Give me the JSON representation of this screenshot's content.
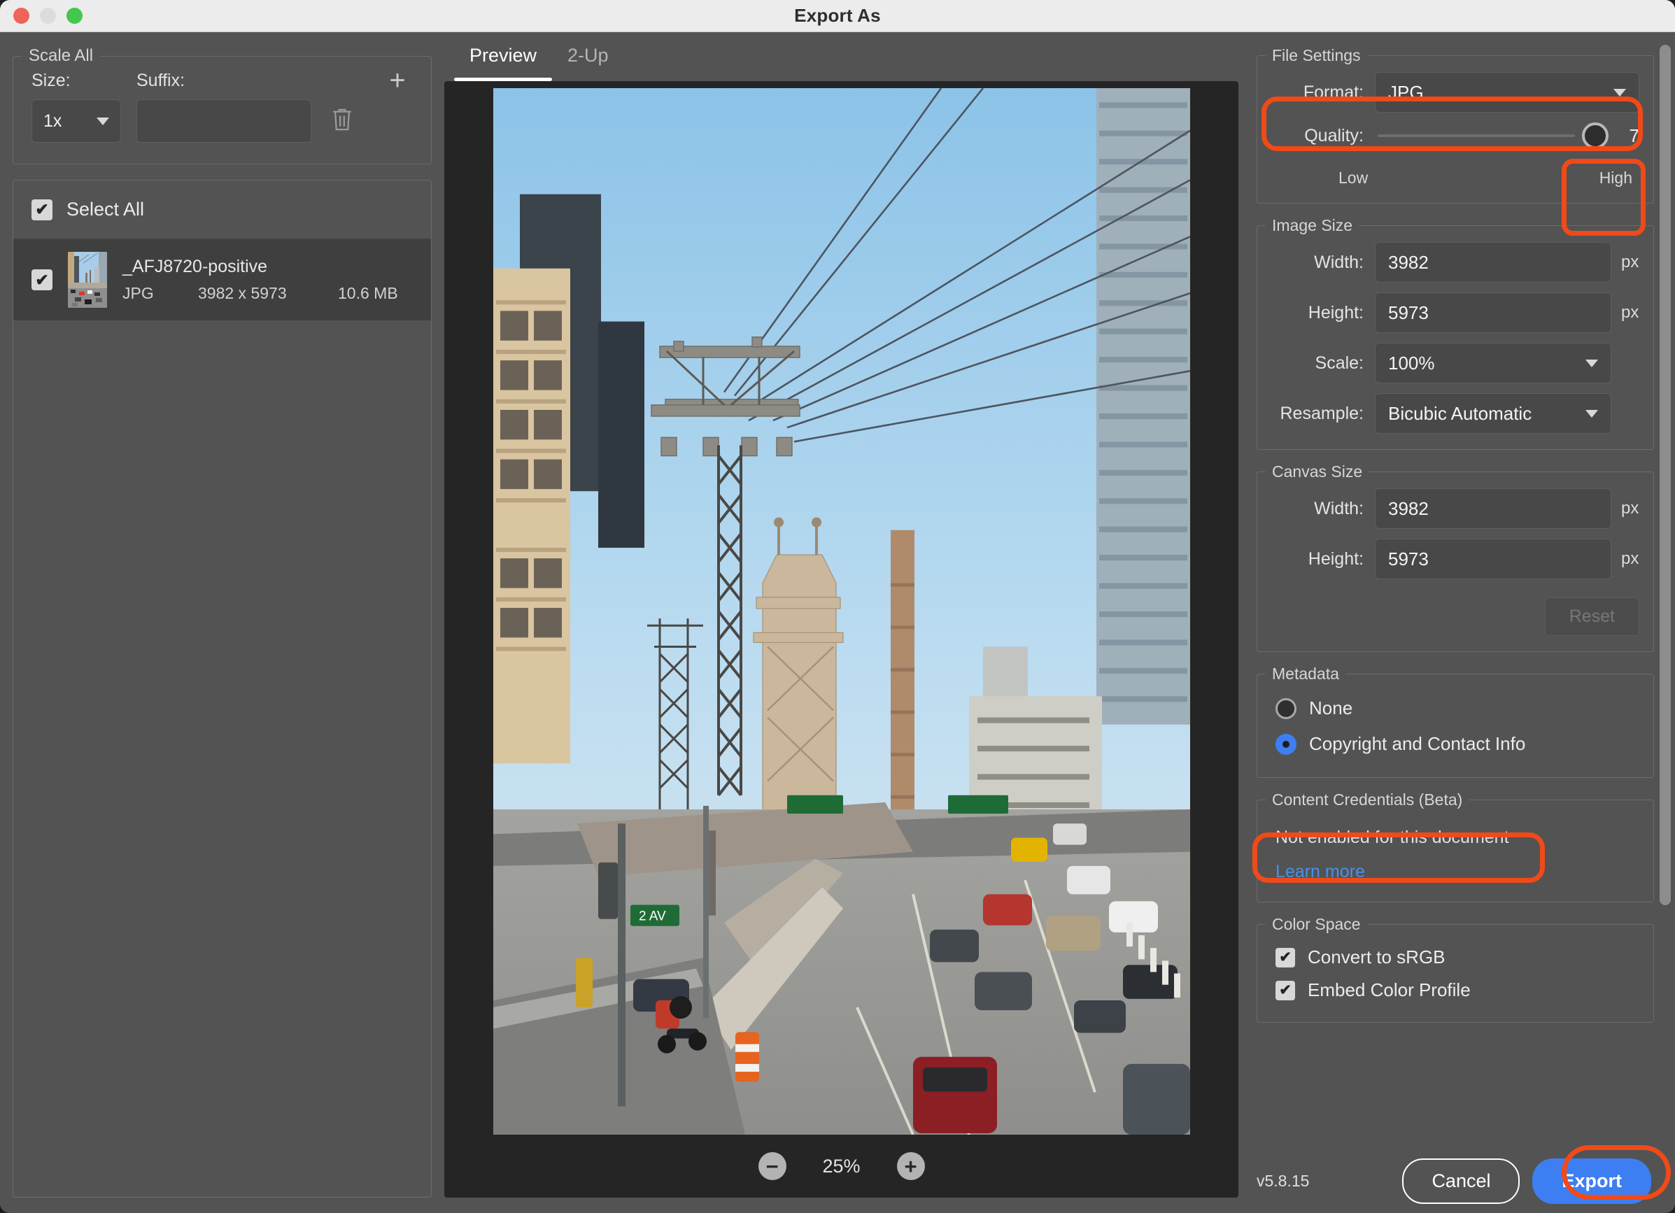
{
  "window": {
    "title": "Export As",
    "traffic_lights": [
      "close-red",
      "minimize-grey",
      "zoom-green"
    ]
  },
  "scale_all": {
    "legend": "Scale All",
    "size_label": "Size:",
    "suffix_label": "Suffix:",
    "size_value": "1x",
    "suffix_value": "",
    "suffix_placeholder": "",
    "add_icon": "+",
    "delete_icon": "trash-icon"
  },
  "file_list": {
    "select_all_label": "Select All",
    "select_all_checked": true,
    "items": [
      {
        "checked": true,
        "name": "_AFJ8720-positive",
        "type": "JPG",
        "dimensions": "3982 x 5973",
        "size": "10.6 MB"
      }
    ]
  },
  "preview": {
    "tabs": [
      {
        "label": "Preview",
        "active": true
      },
      {
        "label": "2-Up",
        "active": false
      }
    ],
    "zoom_out_icon": "−",
    "zoom_level": "25%",
    "zoom_in_icon": "+"
  },
  "file_settings": {
    "legend": "File Settings",
    "format_label": "Format:",
    "format_value": "JPG",
    "quality_label": "Quality:",
    "quality_value": "7",
    "quality_low_label": "Low",
    "quality_high_label": "High"
  },
  "image_size": {
    "legend": "Image Size",
    "width_label": "Width:",
    "width_value": "3982",
    "width_unit": "px",
    "height_label": "Height:",
    "height_value": "5973",
    "height_unit": "px",
    "scale_label": "Scale:",
    "scale_value": "100%",
    "resample_label": "Resample:",
    "resample_value": "Bicubic Automatic"
  },
  "canvas_size": {
    "legend": "Canvas Size",
    "width_label": "Width:",
    "width_value": "3982",
    "width_unit": "px",
    "height_label": "Height:",
    "height_value": "5973",
    "height_unit": "px",
    "reset_label": "Reset"
  },
  "metadata": {
    "legend": "Metadata",
    "options": [
      {
        "label": "None",
        "selected": false
      },
      {
        "label": "Copyright and Contact Info",
        "selected": true
      }
    ]
  },
  "content_credentials": {
    "legend": "Content Credentials (Beta)",
    "status": "Not enabled for this document",
    "link_label": "Learn more"
  },
  "color_space": {
    "legend": "Color Space",
    "options": [
      {
        "label": "Convert to sRGB",
        "checked": true
      },
      {
        "label": "Embed Color Profile",
        "checked": true
      }
    ]
  },
  "footer": {
    "version": "v5.8.15",
    "cancel_label": "Cancel",
    "export_label": "Export"
  },
  "annotations": {
    "highlight_color": "#f04a19",
    "regions": [
      "format-row",
      "quality-value",
      "metadata-copyright-option",
      "export-button"
    ]
  }
}
